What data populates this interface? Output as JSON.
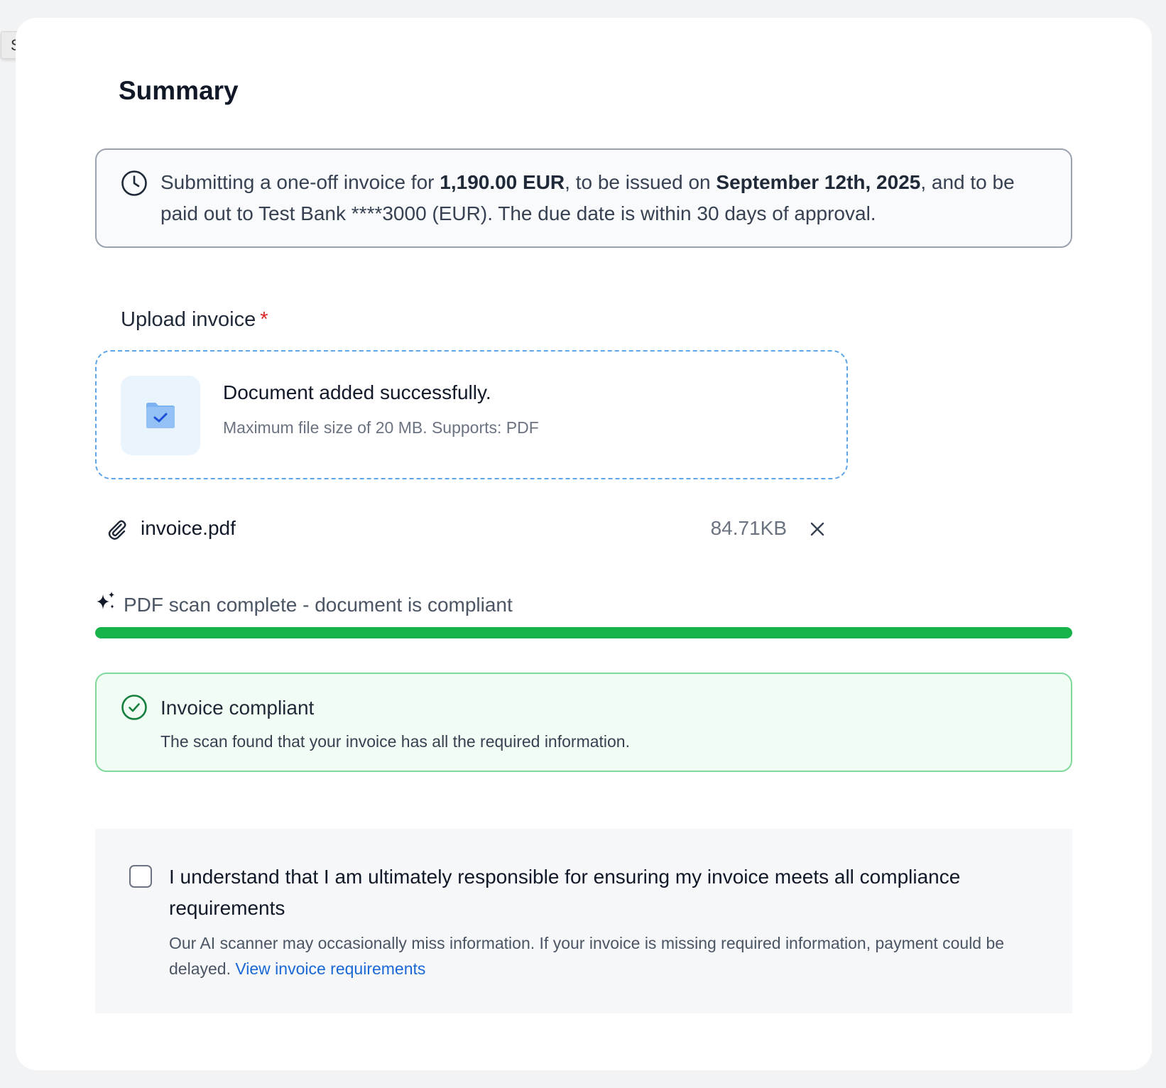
{
  "tooltip": {
    "label": "Summary"
  },
  "page": {
    "title": "Summary"
  },
  "summary": {
    "prefix": "Submitting a one-off invoice for ",
    "amount": "1,190.00 EUR",
    "middle": ", to be issued on ",
    "issue_date": "September 12th, 2025",
    "suffix": ", and to be paid out to Test Bank ****3000 (EUR). The due date is within 30 days of approval."
  },
  "upload": {
    "label": "Upload invoice",
    "required_mark": "*",
    "dropzone_title": "Document added successfully.",
    "dropzone_hint": "Maximum file size of 20 MB. Supports: PDF"
  },
  "file": {
    "name": "invoice.pdf",
    "size": "84.71KB"
  },
  "scan": {
    "status": "PDF scan complete - document is compliant",
    "progress_percent": 100,
    "progress_color": "#16b34a"
  },
  "compliance": {
    "title": "Invoice compliant",
    "description": "The scan found that your invoice has all the required information."
  },
  "acknowledgement": {
    "checked": false,
    "main_text": "I understand that I am ultimately responsible for ensuring my invoice meets all compliance requirements",
    "sub_text": "Our AI scanner may occasionally miss information. If your invoice is missing required information, payment could be delayed. ",
    "link_text": "View invoice requirements"
  },
  "colors": {
    "accent_link": "#1a68d6",
    "success": "#16b34a",
    "required": "#dc2626",
    "dropzone_border": "#60a5e8"
  }
}
